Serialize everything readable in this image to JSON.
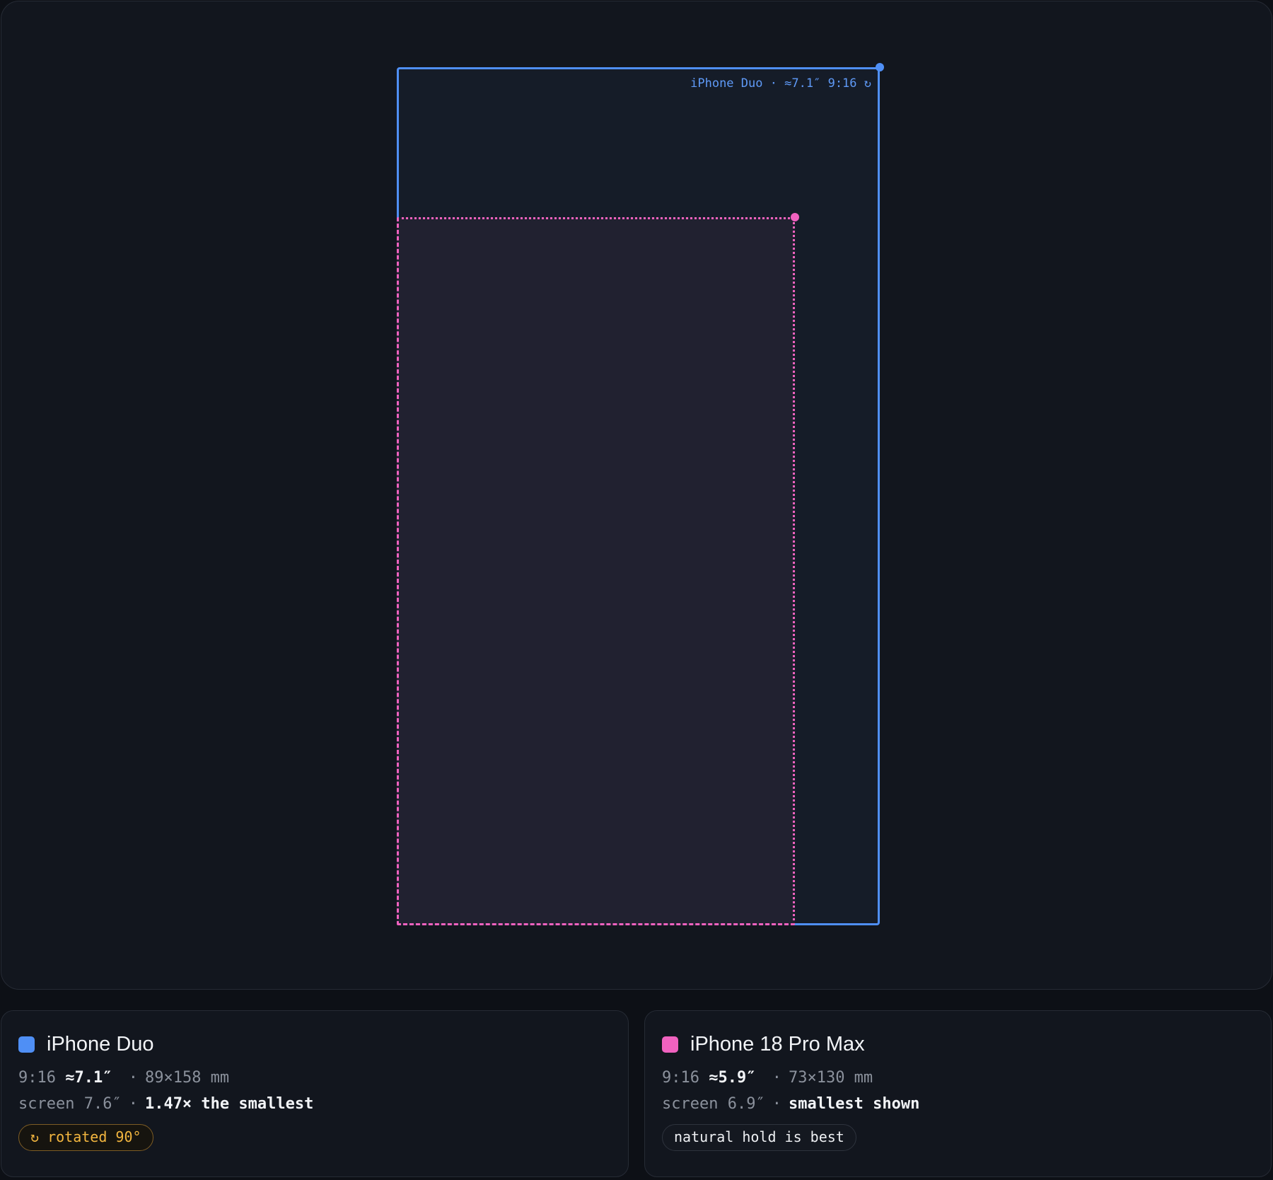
{
  "stage": {
    "frame_label": "iPhone Duo · ≈7.1″ 9:16 ↻"
  },
  "cards": [
    {
      "name": "iPhone Duo",
      "color": "#4f8ff5",
      "ratio": "9:16",
      "size": "≈7.1″",
      "dims": "89×158 mm",
      "screen": "screen 7.6″",
      "comparison": "1.47× the smallest",
      "tag": "↻ rotated 90°",
      "sep": "·"
    },
    {
      "name": "iPhone 18 Pro Max",
      "color": "#f062bf",
      "ratio": "9:16",
      "size": "≈5.9″",
      "dims": "73×130 mm",
      "screen": "screen 6.9″",
      "comparison": "smallest shown",
      "tag": "natural hold is best",
      "sep": "·"
    }
  ]
}
